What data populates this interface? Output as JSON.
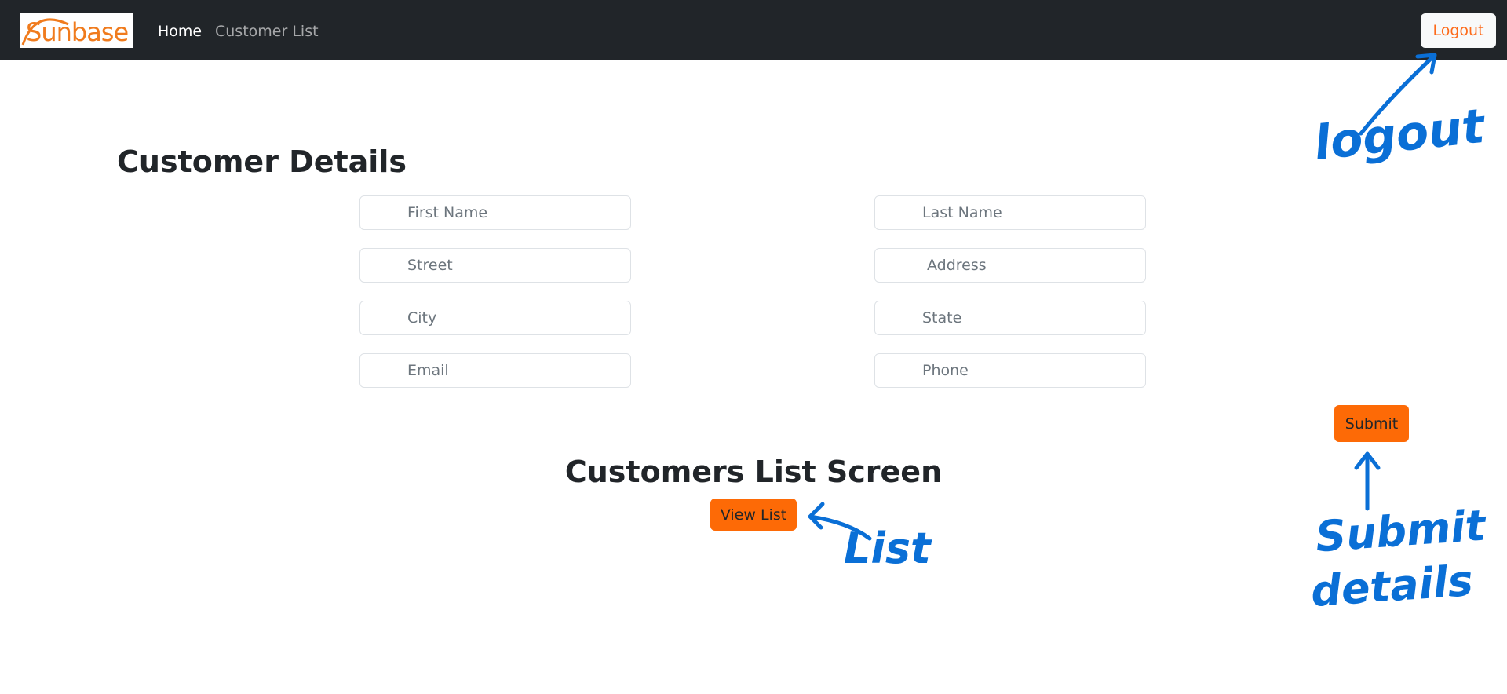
{
  "navbar": {
    "logo_text": "Sunbase",
    "links": [
      {
        "label": "Home"
      },
      {
        "label": "Customer List"
      }
    ],
    "logout_label": "Logout"
  },
  "form": {
    "title": "Customer Details",
    "fields": {
      "first_name": {
        "placeholder": "First Name",
        "value": ""
      },
      "last_name": {
        "placeholder": "Last Name",
        "value": ""
      },
      "street": {
        "placeholder": "Street",
        "value": ""
      },
      "address": {
        "placeholder": "Address",
        "value": ""
      },
      "city": {
        "placeholder": "City",
        "value": ""
      },
      "state": {
        "placeholder": "State",
        "value": ""
      },
      "email": {
        "placeholder": "Email",
        "value": ""
      },
      "phone": {
        "placeholder": "Phone",
        "value": ""
      }
    },
    "submit_label": "Submit"
  },
  "list_section": {
    "title": "Customers List Screen",
    "view_list_label": "View List"
  },
  "annotations": {
    "logout": "logout",
    "list": "List",
    "submit": "Submit",
    "details": "details",
    "color": "#0a6fd6"
  },
  "colors": {
    "navbar_bg": "#212529",
    "accent_orange": "#fd6a06",
    "logo_orange": "#f07b1d"
  }
}
